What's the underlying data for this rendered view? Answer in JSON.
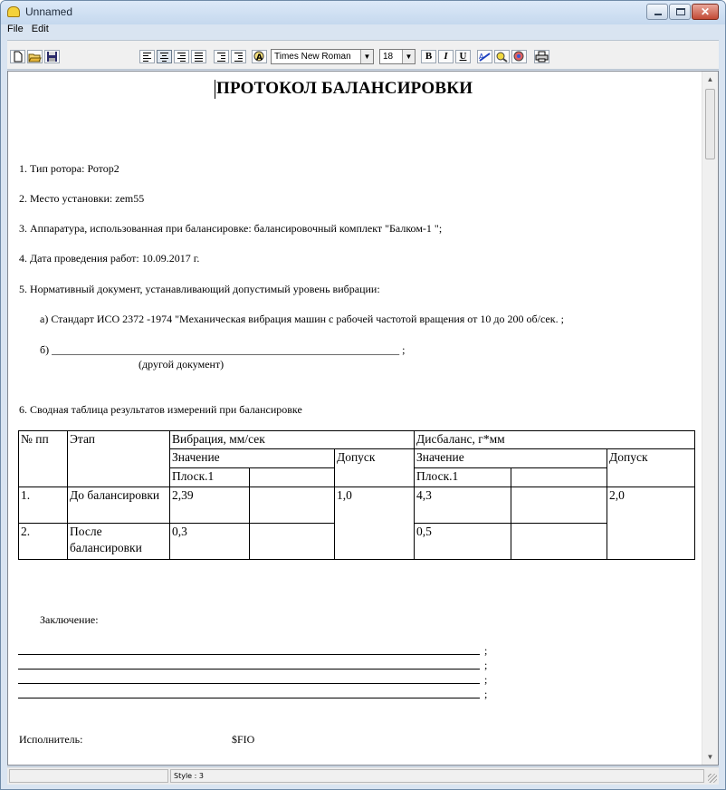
{
  "window": {
    "title": "Unnamed"
  },
  "menu": [
    "File",
    "Edit"
  ],
  "toolbar": {
    "font_name": "Times New Roman",
    "font_size": "18",
    "bold_label": "B",
    "italic_label": "I",
    "underline_label": "U"
  },
  "document": {
    "title": "ПРОТОКОЛ БАЛАНСИРОВКИ",
    "lines": {
      "rotor_type": "1. Тип ротора: Ротор2",
      "location": "2. Место установки: zem55",
      "equipment": "3. Аппаратура, использованная при балансировке: балансировочный комплект \"Балком-1 \";",
      "date": "4. Дата проведения работ:   10.09.2017 г.",
      "normative": "5. Нормативный документ, устанавливающий допустимый уровень  вибрации:",
      "standard_a": "а) Стандарт ИСО 2372 -1974 \"Механическая вибрация машин с рабочей частотой вращения от 10 до 200 об/сек. ;",
      "other_b": "б) ________________________________________________________________ ;",
      "other_doc": "(другой документ)",
      "table_caption": "6. Сводная таблица результатов измерений при балансировке",
      "conclusion": "Заключение:",
      "semicolon": ";",
      "executor_label": "Исполнитель:",
      "executor_value": "$FIO"
    },
    "table": {
      "h_no": "№ пп",
      "h_stage": "Этап",
      "h_vibration": "Вибрация, мм/сек",
      "h_imbalance": "Дисбаланс, г*мм",
      "h_value": "Значение",
      "h_tolerance": "Допуск",
      "h_plane": "Плоск.1",
      "rows": [
        {
          "no": "1.",
          "stage": "До балансировки",
          "vib": "2,39",
          "vib_tol": "1,0",
          "imb": "4,3",
          "imb_tol": "2,0"
        },
        {
          "no": "2.",
          "stage": "После балансировки",
          "vib": "0,3",
          "imb": "0,5"
        }
      ]
    }
  },
  "status": {
    "style": "Style : 3"
  }
}
